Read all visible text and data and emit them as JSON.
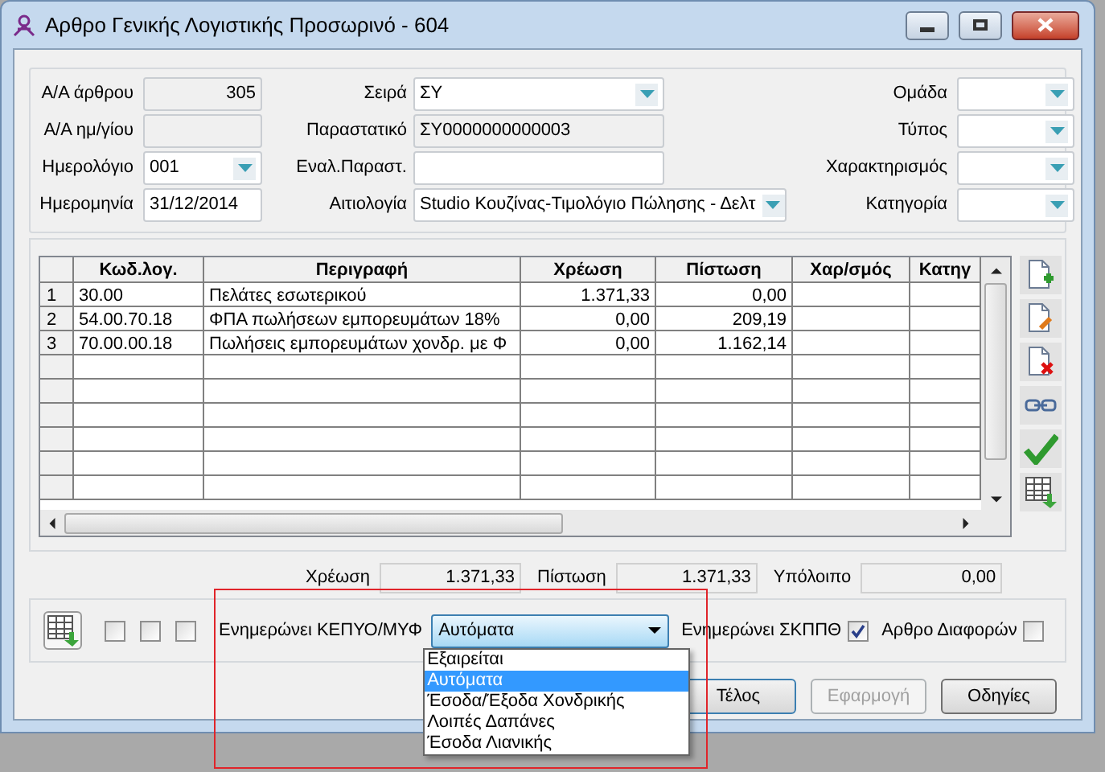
{
  "window": {
    "title": "Αρθρο Γενικής Λογιστικής Προσωρινό - 604"
  },
  "header": {
    "left": [
      {
        "label": "Α/Α άρθρου",
        "value": "305",
        "kind": "number"
      },
      {
        "label": "Α/Α ημ/γίου",
        "kind": "readonly"
      },
      {
        "label": "Ημερολόγιο",
        "value": "001",
        "kind": "combo"
      },
      {
        "label": "Ημερομηνία",
        "value": "31/12/2014",
        "kind": "text"
      }
    ],
    "middle": [
      {
        "label": "Σειρά",
        "value": "ΣΥ",
        "kind": "combo"
      },
      {
        "label": "Παραστατικό",
        "value": "ΣΥ0000000000003",
        "kind": "readonly"
      },
      {
        "label": "Εναλ.Παραστ.",
        "kind": "text"
      },
      {
        "label": "Αιτιολογία",
        "value": "Studio Κουζίνας-Τιμολόγιο Πώλησης - Δελτ",
        "kind": "combo"
      }
    ],
    "right": [
      {
        "label": "Ομάδα",
        "kind": "combo"
      },
      {
        "label": "Τύπος",
        "kind": "combo"
      },
      {
        "label": "Χαρακτηρισμός",
        "kind": "combo"
      },
      {
        "label": "Κατηγορία",
        "kind": "combo"
      }
    ]
  },
  "grid": {
    "columns": [
      "Κωδ.λογ.",
      "Περιγραφή",
      "Χρέωση",
      "Πίστωση",
      "Χαρ/σμός",
      "Κατηγ"
    ],
    "rows": [
      {
        "number": "1",
        "cells": [
          "30.00",
          "Πελάτες εσωτερικού",
          "1.371,33",
          "0,00",
          "",
          ""
        ]
      },
      {
        "number": "2",
        "cells": [
          "54.00.70.18",
          "ΦΠΑ πωλήσεων εμπορευμάτων 18%",
          "0,00",
          "209,19",
          "",
          ""
        ]
      },
      {
        "number": "3",
        "cells": [
          "70.00.00.18",
          "Πωλήσεις εμπορευμάτων χονδρ. με Φ",
          "0,00",
          "1.162,14",
          "",
          ""
        ]
      }
    ]
  },
  "totals": [
    {
      "label": "Χρέωση",
      "value": "1.371,33"
    },
    {
      "label": "Πίστωση",
      "value": "1.371,33"
    },
    {
      "label": "Υπόλοιπο",
      "value": "0,00"
    }
  ],
  "flags": [
    {
      "checked": false
    },
    {
      "checked": false
    },
    {
      "checked": false
    }
  ],
  "kepyo": {
    "label": "Ενημερώνει ΚΕΠΥΟ/ΜΥΦ",
    "value": "Αυτόματα",
    "expanded": true,
    "options": [
      {
        "label": "Εξαιρείται",
        "selected": false
      },
      {
        "label": "Αυτόματα",
        "selected": true
      },
      {
        "label": "Έσοδα/Έξοδα Χονδρικής",
        "selected": false
      },
      {
        "label": "Λοιπές Δαπάνες",
        "selected": false
      },
      {
        "label": "Έσοδα Λιανικής",
        "selected": false
      }
    ]
  },
  "checks": [
    {
      "label": "Ενημερώνει ΣΚΠΠΘ",
      "checked": true
    },
    {
      "label": "Αρθρο Διαφορών",
      "checked": false
    }
  ],
  "buttons": [
    {
      "label": "Τέλος",
      "disabled": false,
      "default": true
    },
    {
      "label": "Εφαρμογή",
      "disabled": true,
      "default": false
    },
    {
      "label": "Οδηγίες",
      "disabled": false,
      "default": false
    }
  ]
}
